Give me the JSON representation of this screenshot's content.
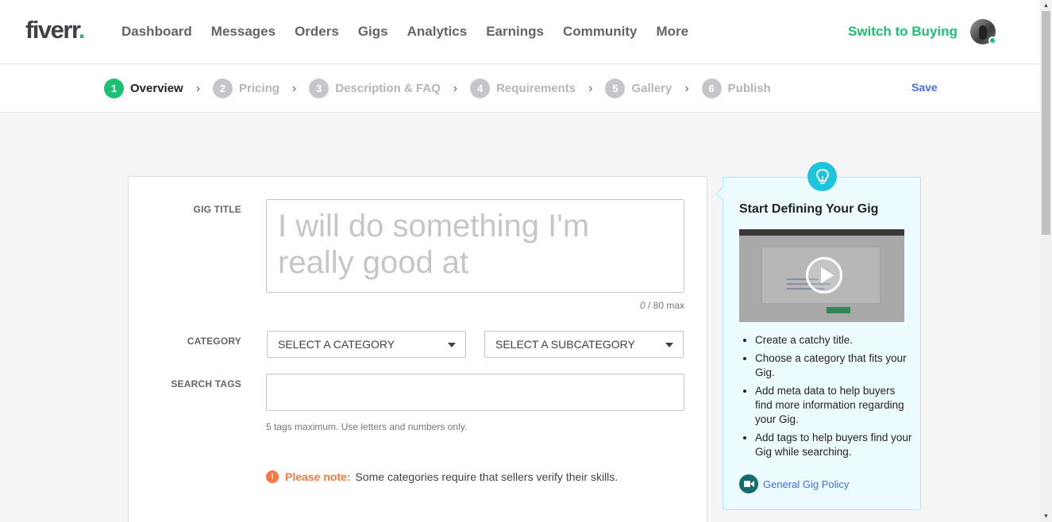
{
  "nav": {
    "logo": "fiverr",
    "logo_dot": ".",
    "links": [
      "Dashboard",
      "Messages",
      "Orders",
      "Gigs",
      "Analytics",
      "Earnings",
      "Community",
      "More"
    ],
    "switch_label": "Switch to Buying",
    "accent_color": "#1dbf73"
  },
  "steps": {
    "items": [
      {
        "num": "1",
        "label": "Overview",
        "active": true
      },
      {
        "num": "2",
        "label": "Pricing",
        "active": false
      },
      {
        "num": "3",
        "label": "Description & FAQ",
        "active": false
      },
      {
        "num": "4",
        "label": "Requirements",
        "active": false
      },
      {
        "num": "5",
        "label": "Gallery",
        "active": false
      },
      {
        "num": "6",
        "label": "Publish",
        "active": false
      }
    ],
    "save_label": "Save"
  },
  "form": {
    "gig_title_label": "GIG TITLE",
    "gig_title_placeholder": "I will do something I'm really good at",
    "char_count": "0",
    "char_max": " / 80 max",
    "category_label": "CATEGORY",
    "category_select": "SELECT A CATEGORY",
    "subcategory_select": "SELECT A SUBCATEGORY",
    "tags_label": "SEARCH TAGS",
    "tags_hint": "5 tags maximum. Use letters and numbers only.",
    "note_label": "Please note:",
    "note_text": "Some categories require that sellers verify their skills."
  },
  "tips": {
    "title": "Start Defining Your Gig",
    "items": [
      "Create a catchy title.",
      "Choose a category that fits your Gig.",
      "Add meta data to help buyers find more information regarding your Gig.",
      "Add tags to help buyers find your Gig while searching."
    ],
    "policy_link": "General Gig Policy"
  }
}
